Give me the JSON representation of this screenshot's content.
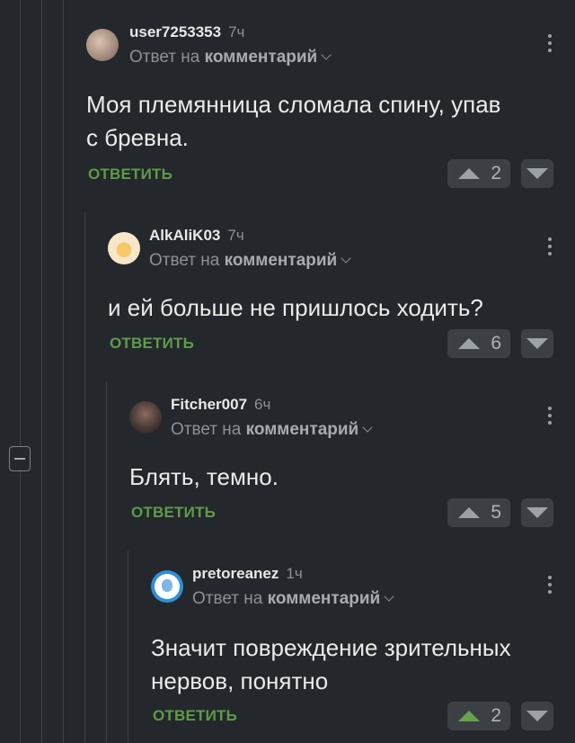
{
  "actions": {
    "reply_label": "ОТВЕТИТЬ",
    "reply_to_prefix": "Ответ на",
    "reply_to_target": "комментарий"
  },
  "comments": [
    {
      "user": "user7253353",
      "time": "7ч",
      "text": "Моя племянница сломала спину, упав с бревна.",
      "rating": "2",
      "upvoted": false,
      "avatar_color": "#a28a7c",
      "avatar_icon": "user-avatar-icon"
    },
    {
      "user": "AlkAliK03",
      "time": "7ч",
      "text": "и ей больше не пришлось ходить?",
      "rating": "6",
      "upvoted": false,
      "avatar_color": "#f1d8a2",
      "avatar_icon": "cheese-avatar-icon"
    },
    {
      "user": "Fitcher007",
      "time": "6ч",
      "text": "Блять, темно.",
      "rating": "5",
      "upvoted": false,
      "avatar_color": "#5a4a44",
      "avatar_icon": "dark-photo-avatar-icon"
    },
    {
      "user": "pretoreanez",
      "time": "1ч",
      "text": "Значит повреждение зрительных нервов, понятно",
      "rating": "2",
      "upvoted": true,
      "avatar_color": "#2f8fd8",
      "avatar_icon": "unicorn-avatar-icon"
    }
  ]
}
